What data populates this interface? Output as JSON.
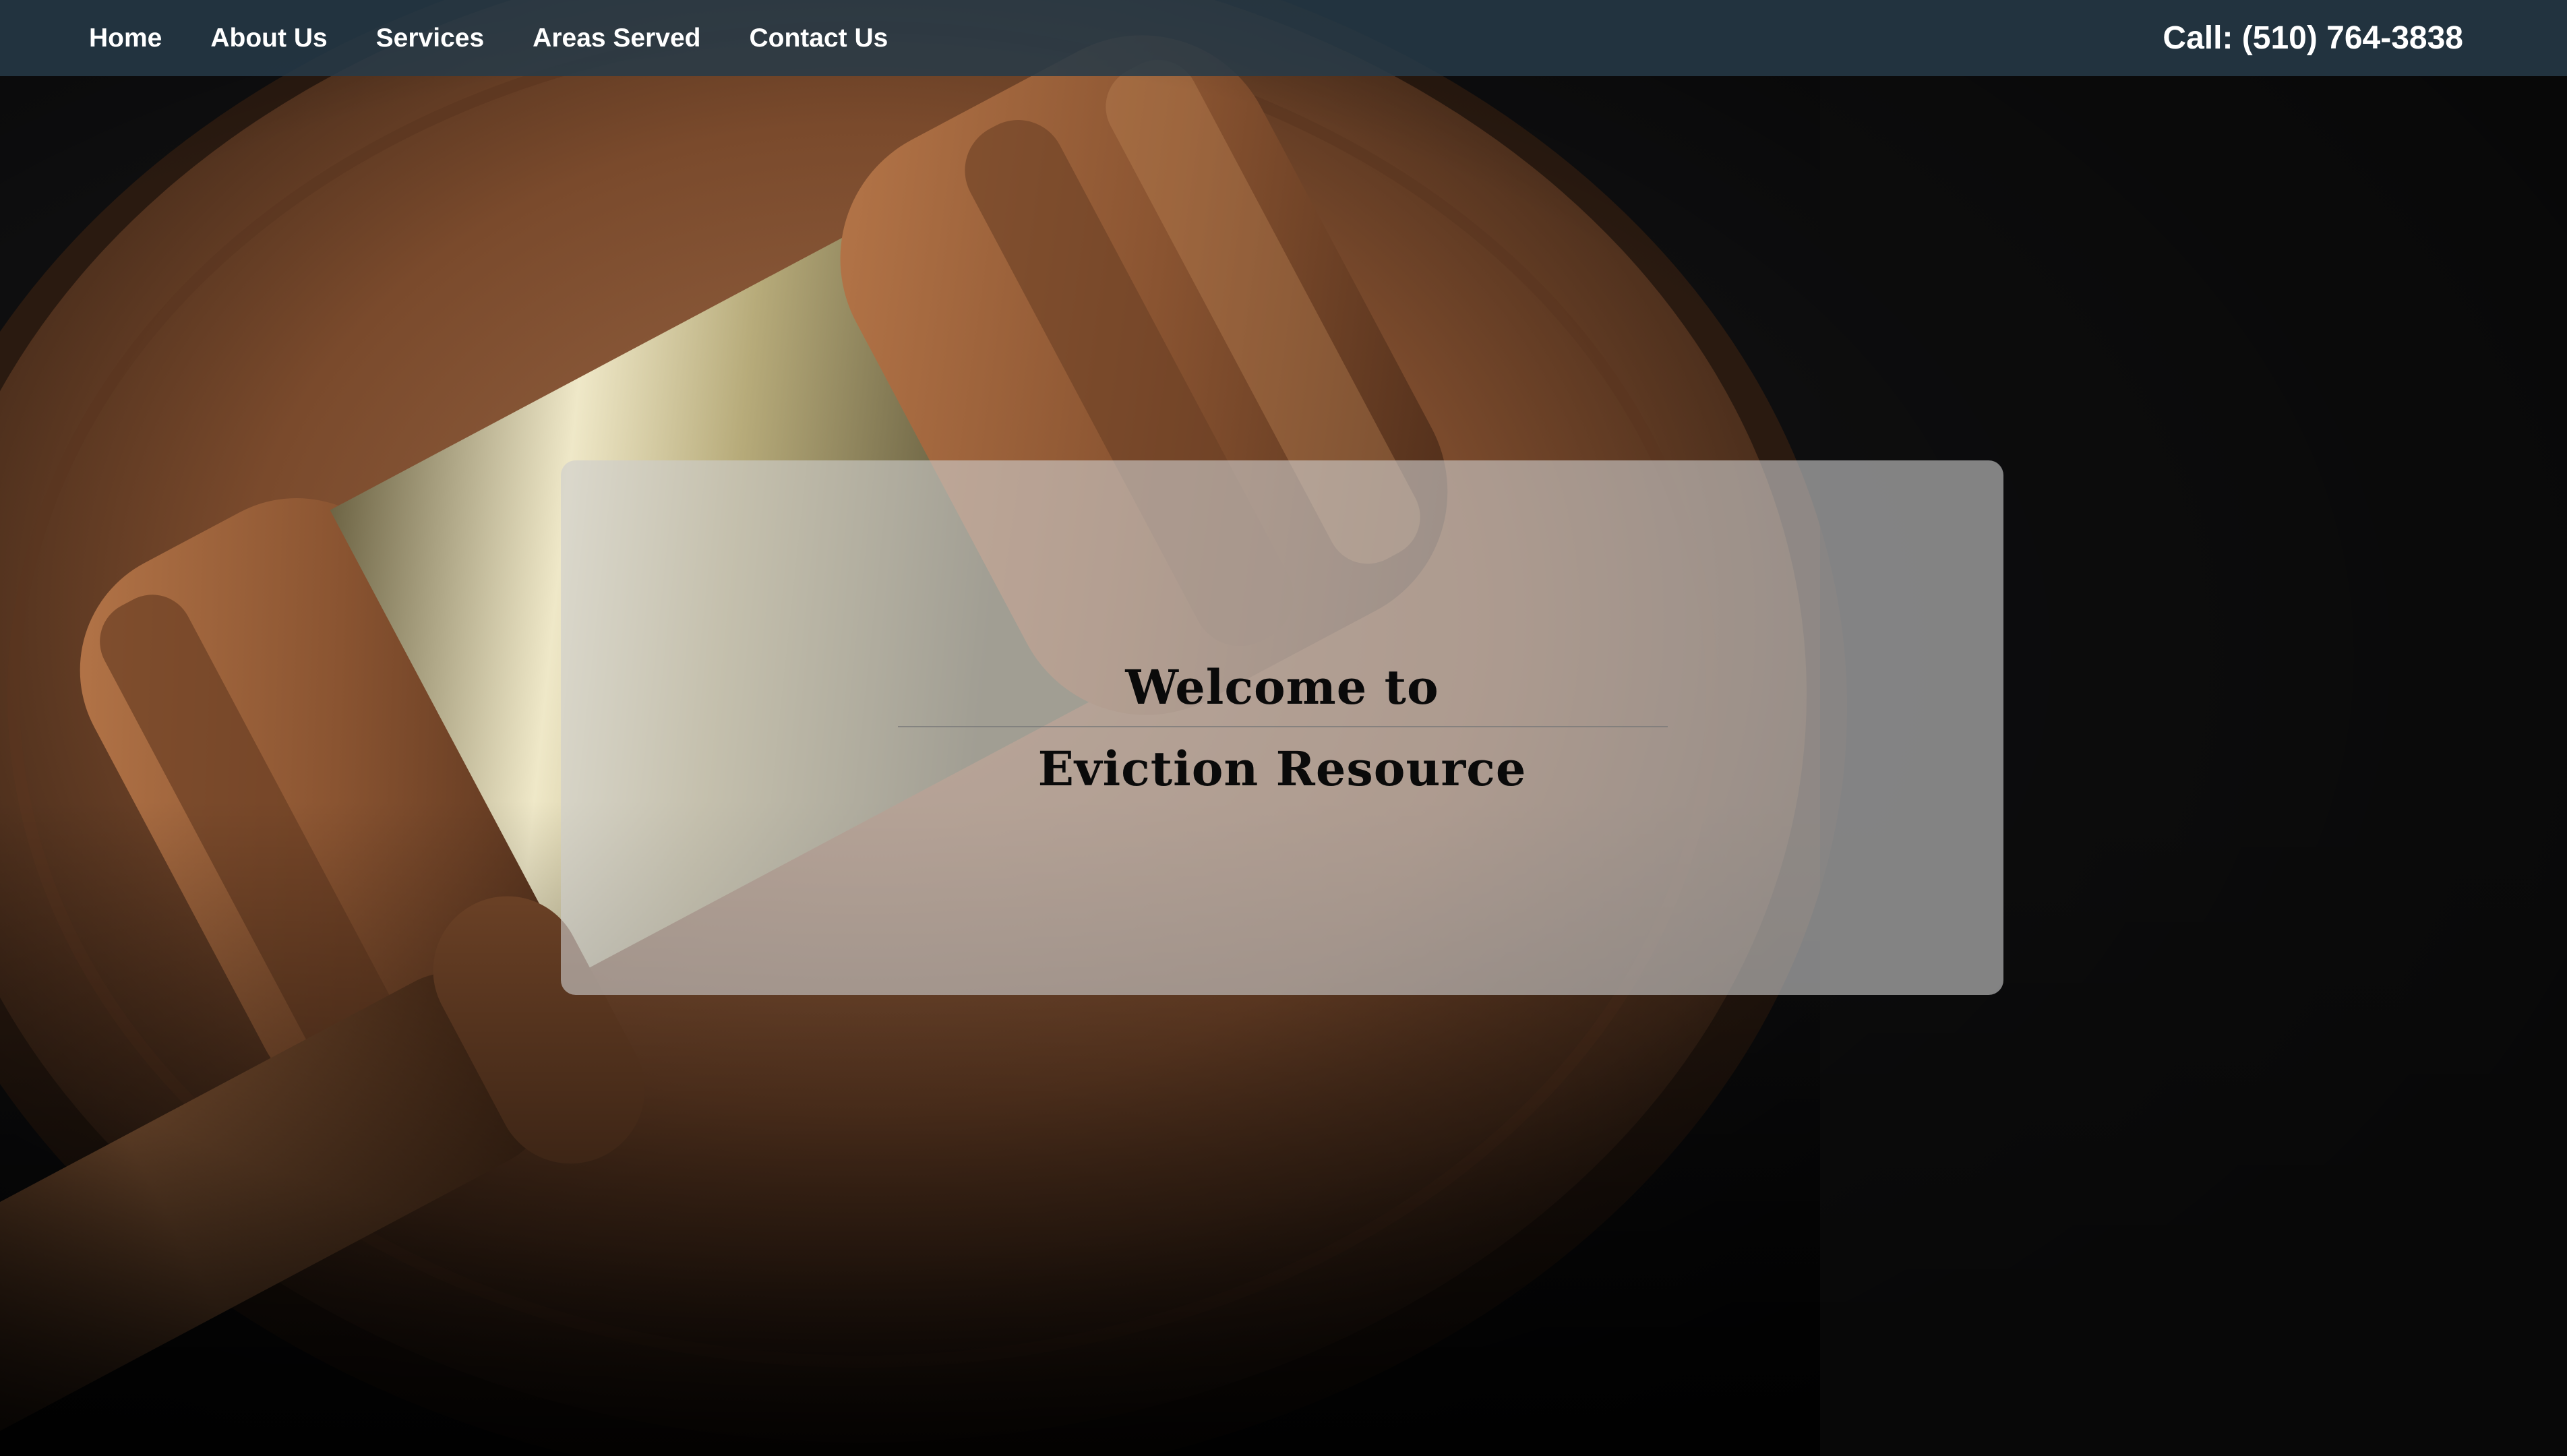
{
  "nav": {
    "links": [
      {
        "label": "Home"
      },
      {
        "label": "About Us"
      },
      {
        "label": "Services"
      },
      {
        "label": "Areas Served"
      },
      {
        "label": "Contact Us"
      }
    ],
    "phone": "Call: (510) 764-3838"
  },
  "hero": {
    "welcome_line1": "Welcome to",
    "welcome_line2": "Eviction Resource",
    "background_image": "judge-gavel-on-sound-block"
  },
  "colors": {
    "navbar_bg": "#263a48",
    "nav_text": "#ffffff",
    "card_bg": "#cdcdcd",
    "heading_text": "#0a0a0a",
    "page_bg": "#0d0d0e"
  }
}
